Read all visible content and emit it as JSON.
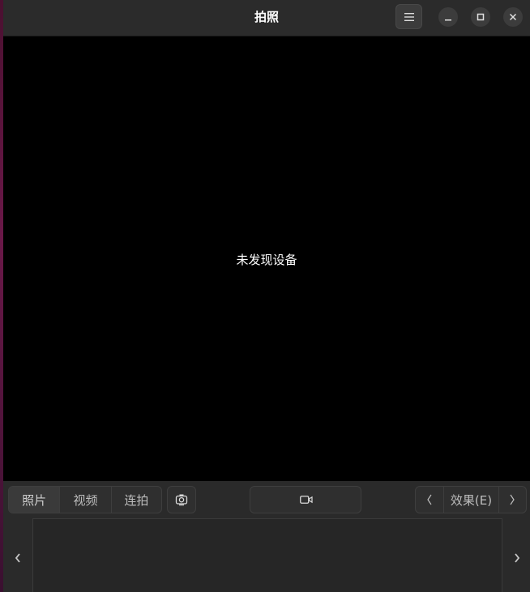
{
  "window": {
    "title": "拍照",
    "menu_icon": "hamburger-icon",
    "minimize_icon": "minimize-icon",
    "maximize_icon": "maximize-icon",
    "close_icon": "close-icon"
  },
  "viewport": {
    "message": "未发现设备"
  },
  "toolbar": {
    "modes": [
      {
        "label": "照片",
        "active": true
      },
      {
        "label": "视频",
        "active": false
      },
      {
        "label": "连拍",
        "active": false
      }
    ],
    "camera_switch_icon": "camera-switch-icon",
    "record_icon": "video-camera-icon",
    "effects": {
      "prev_icon": "chevron-left-icon",
      "label": "效果(E)",
      "next_icon": "chevron-right-icon"
    }
  },
  "gallery": {
    "prev_icon": "chevron-left-icon",
    "next_icon": "chevron-right-icon"
  }
}
